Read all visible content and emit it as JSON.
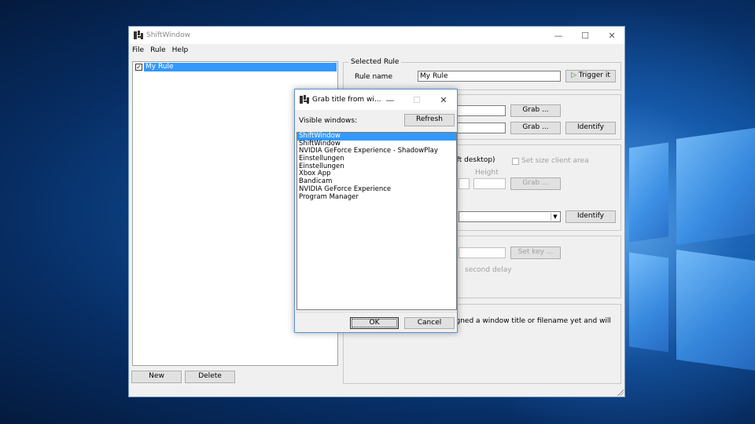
{
  "main_window": {
    "title": "ShiftWindow",
    "controls": {
      "minimize": "—",
      "maximize": "☐",
      "close": "✕"
    },
    "menu": [
      "File",
      "Rule",
      "Help"
    ],
    "rules_tree": [
      {
        "label": "My Rule",
        "checked": true,
        "selected": true
      }
    ],
    "new_button": "New",
    "delete_button": "Delete",
    "selected_rule_group": {
      "title": "Selected Rule",
      "rule_name_label": "Rule name",
      "rule_name_value": "My Rule",
      "trigger_button": "Trigger it"
    },
    "window_group": {
      "grab_button": "Grab ...",
      "grab_button_2": "Grab ...",
      "identify_button": "Identify"
    },
    "position_group": {
      "desktop_text": "pleft desktop)",
      "set_size_label": "Set size client area",
      "height_label": "Height",
      "grab_button": "Grab ...",
      "identify_button": "Identify"
    },
    "hotkey_group": {
      "set_key_button": "Set key ...",
      "delay_label": "second delay"
    },
    "info_text": "igned a window title or filename yet and will"
  },
  "dialog": {
    "title": "Grab title from wi...",
    "controls": {
      "minimize": "—",
      "maximize": "☐",
      "close": "✕"
    },
    "visible_windows_label": "Visible windows:",
    "refresh_button": "Refresh",
    "windows": [
      "ShiftWindow",
      "ShiftWindow",
      "NVIDIA GeForce Experience - ShadowPlay",
      "Einstellungen",
      "Einstellungen",
      "Xbox App",
      "Bandicam",
      "NVIDIA GeForce Experience",
      "Program Manager"
    ],
    "selected_index": 0,
    "ok_button": "OK",
    "cancel_button": "Cancel"
  }
}
